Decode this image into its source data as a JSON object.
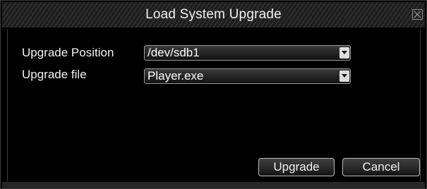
{
  "dialog": {
    "title": "Load System Upgrade",
    "close_icon": "close-icon"
  },
  "form": {
    "position_label": "Upgrade Position",
    "position_value": "/dev/sdb1",
    "file_label": "Upgrade file",
    "file_value": "Player.exe",
    "dropdown_icon": "chevron-down-icon"
  },
  "buttons": {
    "upgrade_label": "Upgrade",
    "cancel_label": "Cancel"
  }
}
